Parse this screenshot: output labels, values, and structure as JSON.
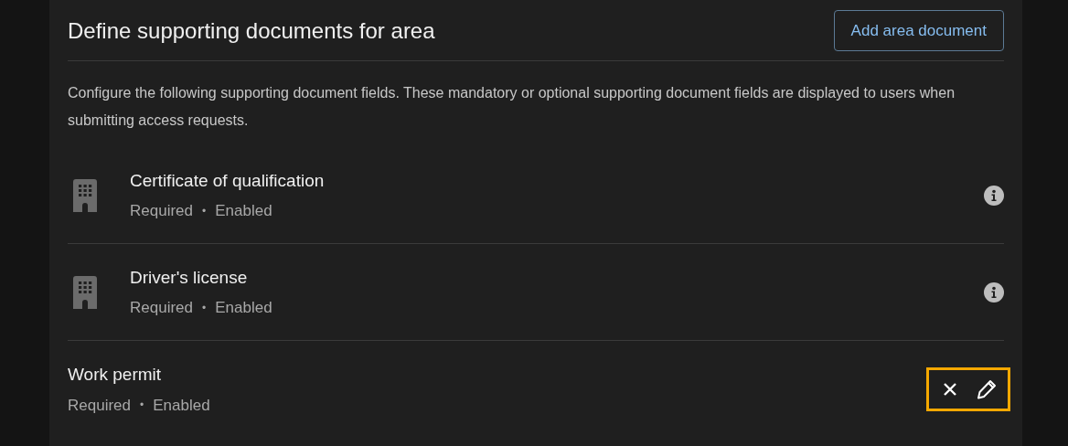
{
  "header": {
    "title": "Define supporting documents for area",
    "button": "Add area document"
  },
  "description": "Configure the following supporting document fields. These mandatory or optional supporting document fields are displayed to users when submitting access requests.",
  "documents": [
    {
      "kind": "info",
      "name": "Certificate of qualification",
      "requirement": "Required",
      "separator": "•",
      "status": "Enabled"
    },
    {
      "kind": "info",
      "name": "Driver's license",
      "requirement": "Required",
      "separator": "•",
      "status": "Enabled"
    },
    {
      "kind": "editing",
      "name": "Work permit",
      "requirement": "Required",
      "separator": "•",
      "status": "Enabled",
      "highlighted": true
    }
  ]
}
